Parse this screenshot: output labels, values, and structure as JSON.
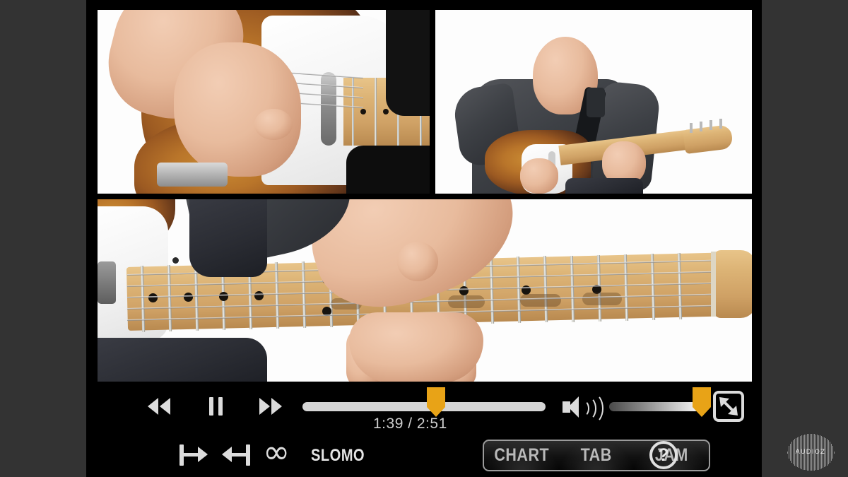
{
  "app": {
    "name": "guitar-lesson-video-player",
    "background_color": "#333333",
    "player_background": "#000000",
    "accent_color": "#e8a317"
  },
  "video": {
    "panels": [
      {
        "id": "picking-hand-closeup",
        "position": "top-left",
        "description": "Close-up of picking hand over white pickguard of sunburst Telecaster"
      },
      {
        "id": "full-body-player",
        "position": "top-right",
        "description": "Bald guitarist in dark shirt playing sunburst Telecaster on white background"
      },
      {
        "id": "fretboard-closeup",
        "position": "bottom",
        "description": "Wide close-up of fretting hand on maple fretboard"
      }
    ]
  },
  "transport": {
    "rewind_label": "Rewind",
    "pause_label": "Pause",
    "forward_label": "Fast Forward"
  },
  "progress": {
    "current_time": "1:39",
    "total_time": "2:51",
    "time_display": "1:39 / 2:51",
    "percent": 55
  },
  "volume": {
    "label": "Volume",
    "percent": 100
  },
  "display": {
    "shrink_label": "Exit Fullscreen"
  },
  "loop_tools": {
    "loop_in_label": "Set Loop In",
    "loop_out_label": "Set Loop Out",
    "loop_toggle_label": "∞",
    "slomo_label": "SLOMO"
  },
  "view_modes": {
    "options": [
      {
        "label": "CHART"
      },
      {
        "label": "TAB"
      },
      {
        "label": "JAM"
      }
    ],
    "selected": "CHART"
  },
  "help": {
    "label": "?"
  },
  "watermark": {
    "text": "AUDIOZ"
  }
}
